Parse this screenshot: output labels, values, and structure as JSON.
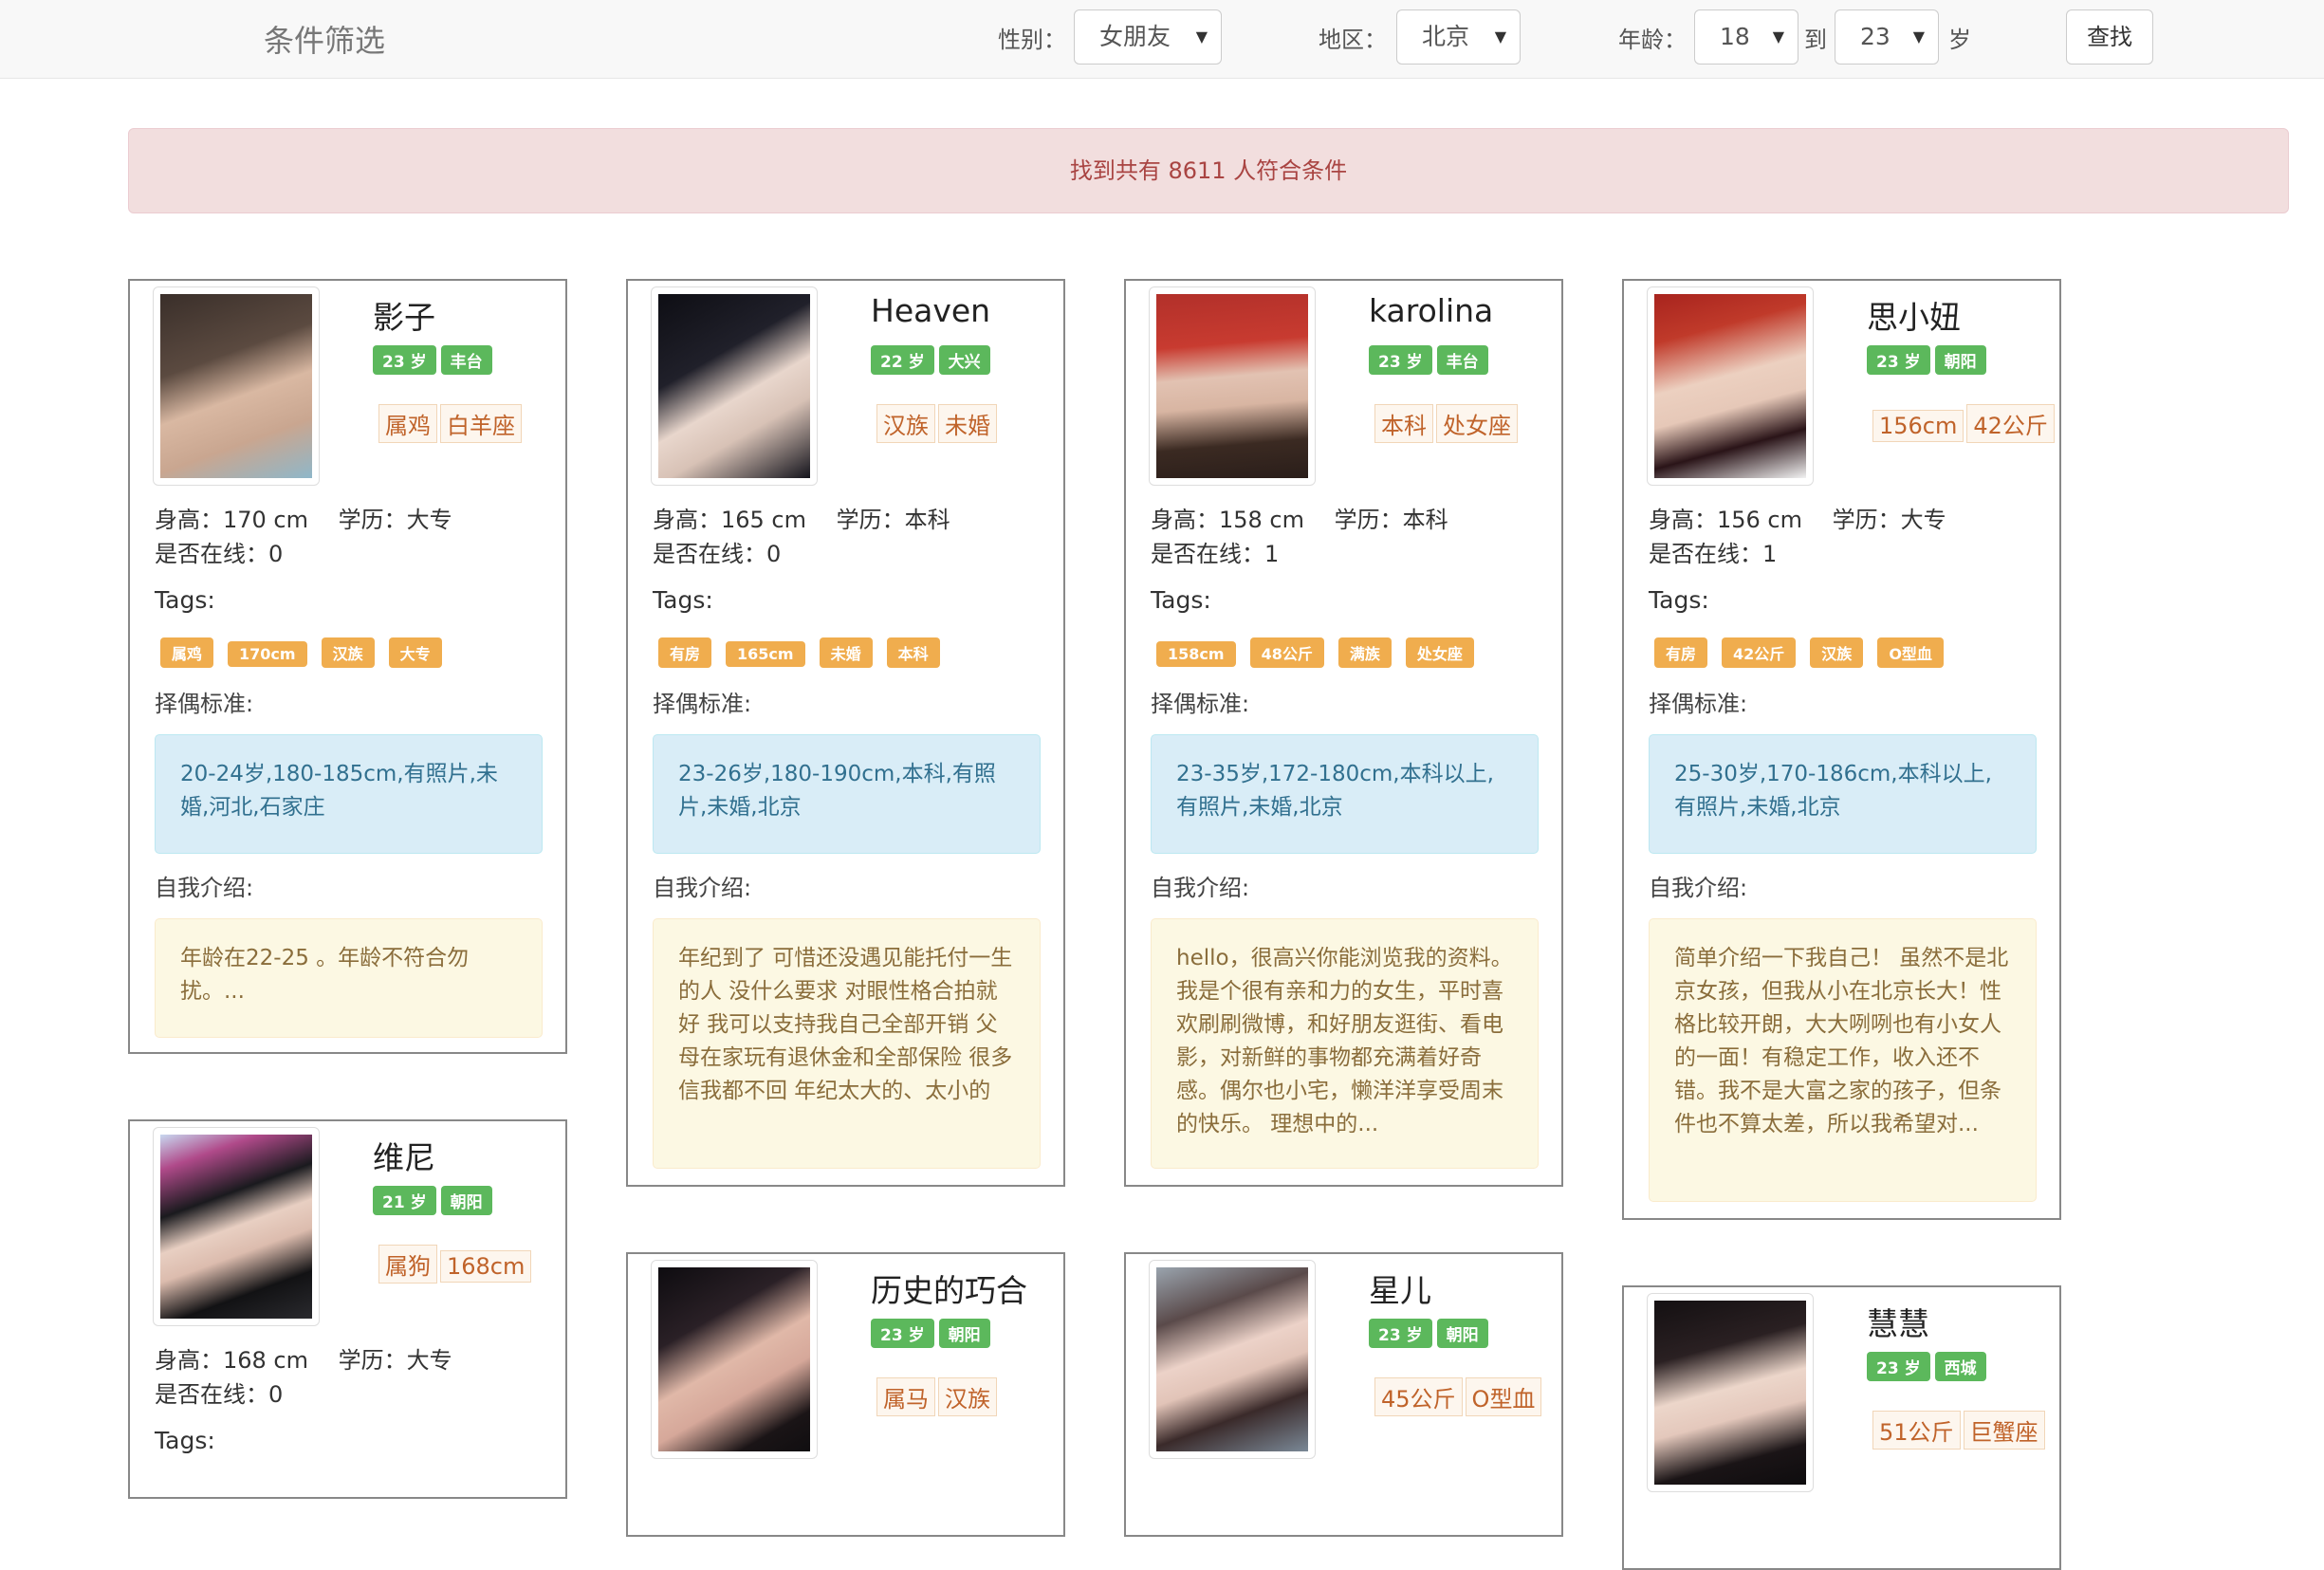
{
  "filter_bar": {
    "brand": "条件筛选",
    "gender_label": "性别：",
    "gender_value": "女朋友",
    "region_label": "地区：",
    "region_value": "北京",
    "age_label": "年龄：",
    "age_min": "18",
    "to_label": "到",
    "age_max": "23",
    "age_unit": "岁",
    "search_button": "查找"
  },
  "result_alert": "找到共有 8611 人符合条件",
  "labels": {
    "tags": "Tags:",
    "criteria": "择偶标准:",
    "intro": "自我介绍:"
  },
  "profiles": [
    {
      "name": "影子",
      "age_badge": "23 岁",
      "district_badge": "丰台",
      "sub1": "属鸡",
      "sub2": "白羊座",
      "height_line": "身高：170 cm　 学历：大专",
      "online_line": "是否在线：0",
      "tags": [
        "属鸡",
        "170cm",
        "汉族",
        "大专"
      ],
      "criteria": "20-24岁,180-185cm,有照片,未婚,河北,石家庄",
      "intro": "年龄在22-25 。年龄不符合勿扰。..."
    },
    {
      "name": "Heaven",
      "age_badge": "22 岁",
      "district_badge": "大兴",
      "sub1": "汉族",
      "sub2": "未婚",
      "height_line": "身高：165 cm　 学历：本科",
      "online_line": "是否在线：0",
      "tags": [
        "有房",
        "165cm",
        "未婚",
        "本科"
      ],
      "criteria": "23-26岁,180-190cm,本科,有照片,未婚,北京",
      "intro": "年纪到了 可惜还没遇见能托付一生的人 没什么要求 对眼性格合拍就好 我可以支持我自己全部开销 父母在家玩有退休金和全部保险 很多信我都不回 年纪太大的、太小的"
    },
    {
      "name": "karolina",
      "age_badge": "23 岁",
      "district_badge": "丰台",
      "sub1": "本科",
      "sub2": "处女座",
      "height_line": "身高：158 cm　 学历：本科",
      "online_line": "是否在线：1",
      "tags": [
        "158cm",
        "48公斤",
        "满族",
        "处女座"
      ],
      "criteria": "23-35岁,172-180cm,本科以上,有照片,未婚,北京",
      "intro": "hello，很高兴你能浏览我的资料。我是个很有亲和力的女生，平时喜欢刷刷微博，和好朋友逛街、看电影，对新鲜的事物都充满着好奇感。偶尔也小宅，懒洋洋享受周末的快乐。 理想中的..."
    },
    {
      "name": "思小妞",
      "age_badge": "23 岁",
      "district_badge": "朝阳",
      "sub1": "156cm",
      "sub2": "42公斤",
      "height_line": "身高：156 cm　 学历：大专",
      "online_line": "是否在线：1",
      "tags": [
        "有房",
        "42公斤",
        "汉族",
        "O型血"
      ],
      "criteria": "25-30岁,170-186cm,本科以上,有照片,未婚,北京",
      "intro": "简单介绍一下我自己！ 虽然不是北京女孩，但我从小在北京长大！性格比较开朗，大大咧咧也有小女人的一面！有稳定工作，收入还不错。我不是大富之家的孩子，但条件也不算太差，所以我希望对..."
    },
    {
      "name": "维尼",
      "age_badge": "21 岁",
      "district_badge": "朝阳",
      "sub1": "属狗",
      "sub2": "168cm",
      "height_line": "身高：168 cm　 学历：大专",
      "online_line": "是否在线：0"
    },
    {
      "name": "历史的巧合",
      "age_badge": "23 岁",
      "district_badge": "朝阳",
      "sub1": "属马",
      "sub2": "汉族"
    },
    {
      "name": "星儿",
      "age_badge": "23 岁",
      "district_badge": "朝阳",
      "sub1": "45公斤",
      "sub2": "O型血"
    },
    {
      "name": "慧慧",
      "age_badge": "23 岁",
      "district_badge": "西城",
      "sub1": "51公斤",
      "sub2": "巨蟹座"
    }
  ]
}
